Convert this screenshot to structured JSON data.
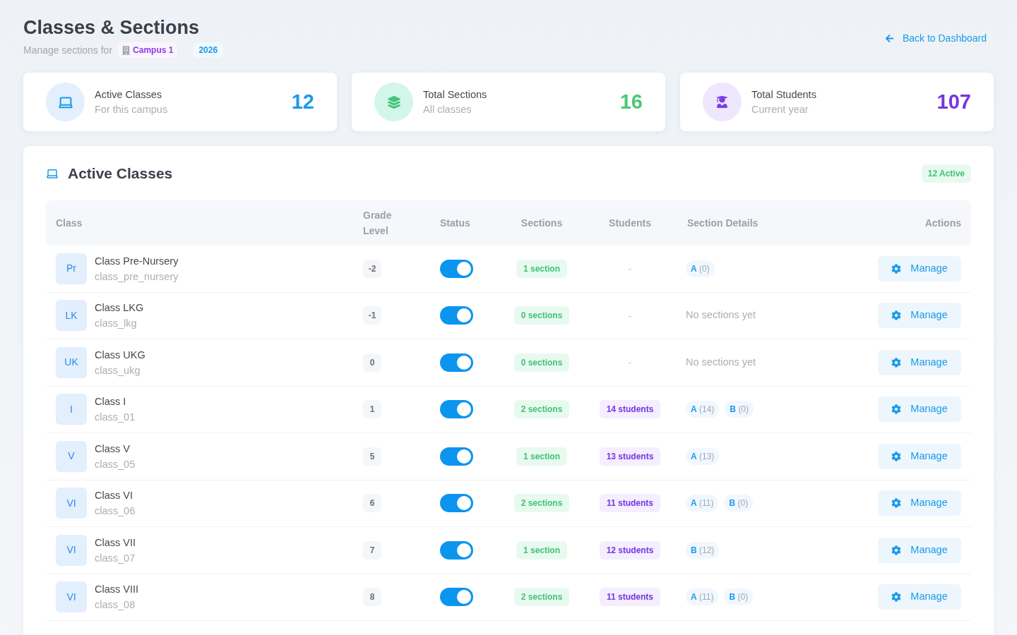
{
  "header": {
    "title": "Classes & Sections",
    "subtitle": "Manage sections for",
    "campus": "Campus 1",
    "year": "2026",
    "back_link": "Back to Dashboard"
  },
  "stats": [
    {
      "kind": "classes",
      "title": "Active Classes",
      "subtitle": "For this campus",
      "value": "12"
    },
    {
      "kind": "sections",
      "title": "Total Sections",
      "subtitle": "All classes",
      "value": "16"
    },
    {
      "kind": "students",
      "title": "Total Students",
      "subtitle": "Current year",
      "value": "107"
    }
  ],
  "panel": {
    "title": "Active Classes",
    "badge": "12 Active"
  },
  "table": {
    "columns": [
      "Class",
      "Grade Level",
      "Status",
      "Sections",
      "Students",
      "Section Details",
      "Actions"
    ],
    "rows": [
      {
        "initials": "Pr",
        "name": "Class Pre-Nursery",
        "code": "class_pre_nursery",
        "grade": "-2",
        "on": true,
        "sections": "1 section",
        "students": {
          "kind": "empty",
          "text": "-"
        },
        "section_chips": [
          {
            "letter": "A",
            "count": "(0)"
          }
        ],
        "action": "Manage"
      },
      {
        "initials": "LK",
        "name": "Class LKG",
        "code": "class_lkg",
        "grade": "-1",
        "on": true,
        "sections": "0 sections",
        "students": {
          "kind": "empty",
          "text": "-"
        },
        "detail_note": "No sections yet",
        "action": "Manage"
      },
      {
        "initials": "UK",
        "name": "Class UKG",
        "code": "class_ukg",
        "grade": "0",
        "on": true,
        "sections": "0 sections",
        "students": {
          "kind": "empty",
          "text": "-"
        },
        "detail_note": "No sections yet",
        "action": "Manage"
      },
      {
        "initials": "I",
        "name": "Class I",
        "code": "class_01",
        "grade": "1",
        "on": true,
        "sections": "2 sections",
        "students": {
          "kind": "badge",
          "text": "14 students"
        },
        "section_chips": [
          {
            "letter": "A",
            "count": "(14)"
          },
          {
            "letter": "B",
            "count": "(0)"
          }
        ],
        "action": "Manage"
      },
      {
        "initials": "V",
        "name": "Class V",
        "code": "class_05",
        "grade": "5",
        "on": true,
        "sections": "1 section",
        "students": {
          "kind": "badge",
          "text": "13 students"
        },
        "section_chips": [
          {
            "letter": "A",
            "count": "(13)"
          }
        ],
        "action": "Manage"
      },
      {
        "initials": "VI",
        "name": "Class VI",
        "code": "class_06",
        "grade": "6",
        "on": true,
        "sections": "2 sections",
        "students": {
          "kind": "badge",
          "text": "11 students"
        },
        "section_chips": [
          {
            "letter": "A",
            "count": "(11)"
          },
          {
            "letter": "B",
            "count": "(0)"
          }
        ],
        "action": "Manage"
      },
      {
        "initials": "VI",
        "name": "Class VII",
        "code": "class_07",
        "grade": "7",
        "on": true,
        "sections": "1 section",
        "students": {
          "kind": "badge",
          "text": "12 students"
        },
        "section_chips": [
          {
            "letter": "B",
            "count": "(12)"
          }
        ],
        "action": "Manage"
      },
      {
        "initials": "VI",
        "name": "Class VIII",
        "code": "class_08",
        "grade": "8",
        "on": true,
        "sections": "2 sections",
        "students": {
          "kind": "badge",
          "text": "11 students"
        },
        "section_chips": [
          {
            "letter": "A",
            "count": "(11)"
          },
          {
            "letter": "B",
            "count": "(0)"
          }
        ],
        "action": "Manage"
      }
    ]
  }
}
